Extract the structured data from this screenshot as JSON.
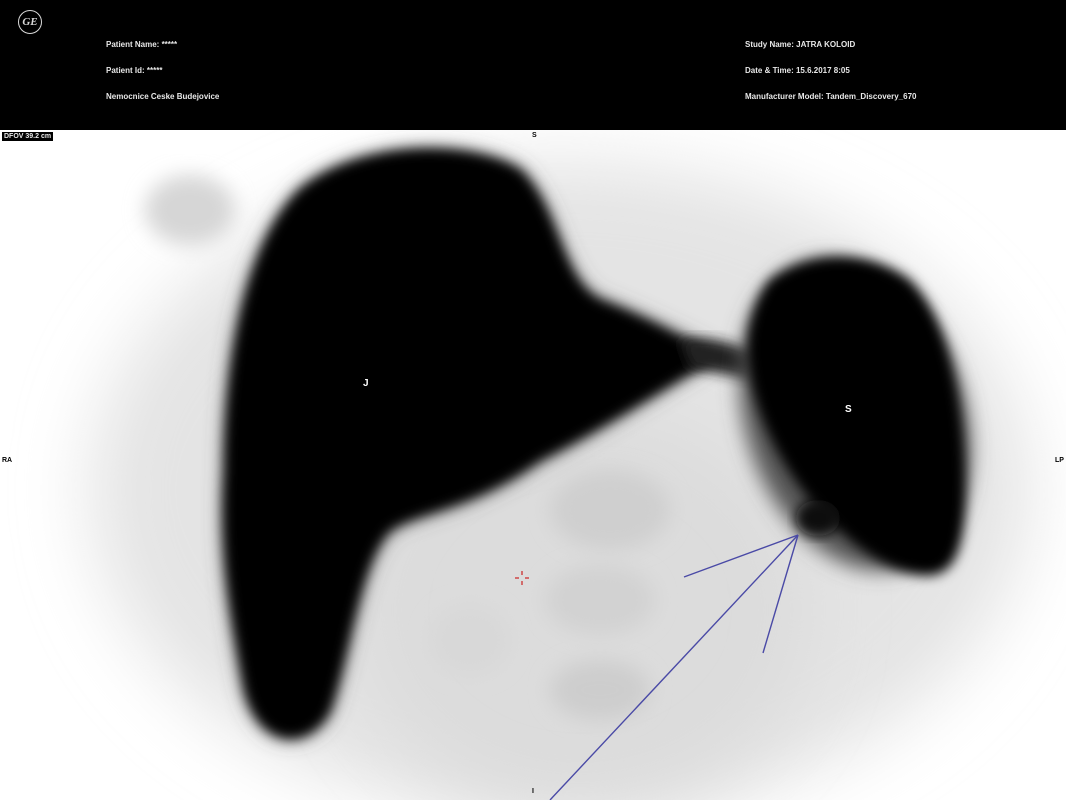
{
  "header": {
    "logo_icon": "ge-logo-icon",
    "patient_name": "Patient Name: *****",
    "patient_id": "Patient Id: *****",
    "institution": "Nemocnice Ceske Budejovice",
    "study_name": "Study Name: JATRA KOLOID",
    "date_time": "Date & Time: 15.6.2017 8:05",
    "manufacturer_model": "Manufacturer Model: Tandem_Discovery_670"
  },
  "viewport": {
    "dfov": "DFOV 39.2 cm",
    "orientation_top": "S",
    "orientation_left": "RA",
    "orientation_right": "LP",
    "orientation_bottom": "I",
    "label_liver": "J",
    "label_spleen": "S",
    "cursor_icon": "crosshair-icon",
    "arrow_icon": "arrow-annotation-icon",
    "arrow_color": "#4a4aa6",
    "cursor_color": "#cc2222"
  }
}
